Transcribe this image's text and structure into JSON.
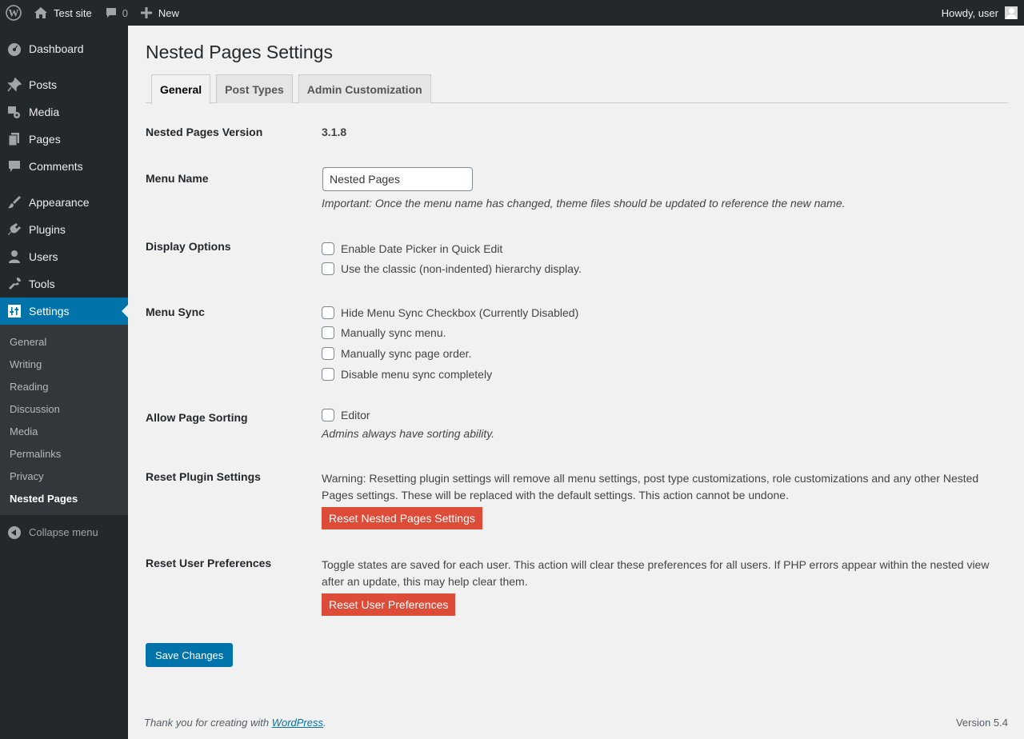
{
  "adminbar": {
    "site_name": "Test site",
    "comments_count": "0",
    "new_label": "New",
    "howdy": "Howdy, user"
  },
  "sidebar": {
    "items": [
      {
        "label": "Dashboard",
        "icon": "dashboard-icon"
      },
      {
        "label": "Posts",
        "icon": "pin-icon"
      },
      {
        "label": "Media",
        "icon": "media-icon"
      },
      {
        "label": "Pages",
        "icon": "pages-icon"
      },
      {
        "label": "Comments",
        "icon": "comment-icon"
      },
      {
        "label": "Appearance",
        "icon": "brush-icon"
      },
      {
        "label": "Plugins",
        "icon": "plug-icon"
      },
      {
        "label": "Users",
        "icon": "user-icon"
      },
      {
        "label": "Tools",
        "icon": "wrench-icon"
      },
      {
        "label": "Settings",
        "icon": "settings-sliders-icon"
      }
    ],
    "submenu": [
      "General",
      "Writing",
      "Reading",
      "Discussion",
      "Media",
      "Permalinks",
      "Privacy",
      "Nested Pages"
    ],
    "collapse_label": "Collapse menu"
  },
  "page": {
    "title": "Nested Pages Settings",
    "tabs": [
      "General",
      "Post Types",
      "Admin Customization"
    ]
  },
  "settings": {
    "version": {
      "label": "Nested Pages Version",
      "value": "3.1.8"
    },
    "menu_name": {
      "label": "Menu Name",
      "value": "Nested Pages",
      "description": "Important: Once the menu name has changed, theme files should be updated to reference the new name."
    },
    "display_options": {
      "label": "Display Options",
      "options": [
        "Enable Date Picker in Quick Edit",
        "Use the classic (non-indented) hierarchy display."
      ]
    },
    "menu_sync": {
      "label": "Menu Sync",
      "options": [
        "Hide Menu Sync Checkbox (Currently Disabled)",
        "Manually sync menu.",
        "Manually sync page order.",
        "Disable menu sync completely"
      ]
    },
    "page_sorting": {
      "label": "Allow Page Sorting",
      "option": "Editor",
      "description": "Admins always have sorting ability."
    },
    "reset_plugin": {
      "label": "Reset Plugin Settings",
      "warning": "Warning: Resetting plugin settings will remove all menu settings, post type customizations, role customizations and any other Nested Pages settings. These will be replaced with the default settings. This action cannot be undone.",
      "button": "Reset Nested Pages Settings"
    },
    "reset_user": {
      "label": "Reset User Preferences",
      "text": "Toggle states are saved for each user. This action will clear these preferences for all users. If PHP errors appear within the nested view after an update, this may help clear them.",
      "button": "Reset User Preferences"
    }
  },
  "save_button": "Save Changes",
  "footer": {
    "thanks_prefix": "Thank you for creating with ",
    "thanks_link": "WordPress",
    "thanks_suffix": ".",
    "version": "Version 5.4"
  },
  "colors": {
    "adminbar_bg": "#23282d",
    "sidebar_current": "#0073aa",
    "danger_button": "#dd4b39",
    "primary_button": "#0073aa"
  }
}
